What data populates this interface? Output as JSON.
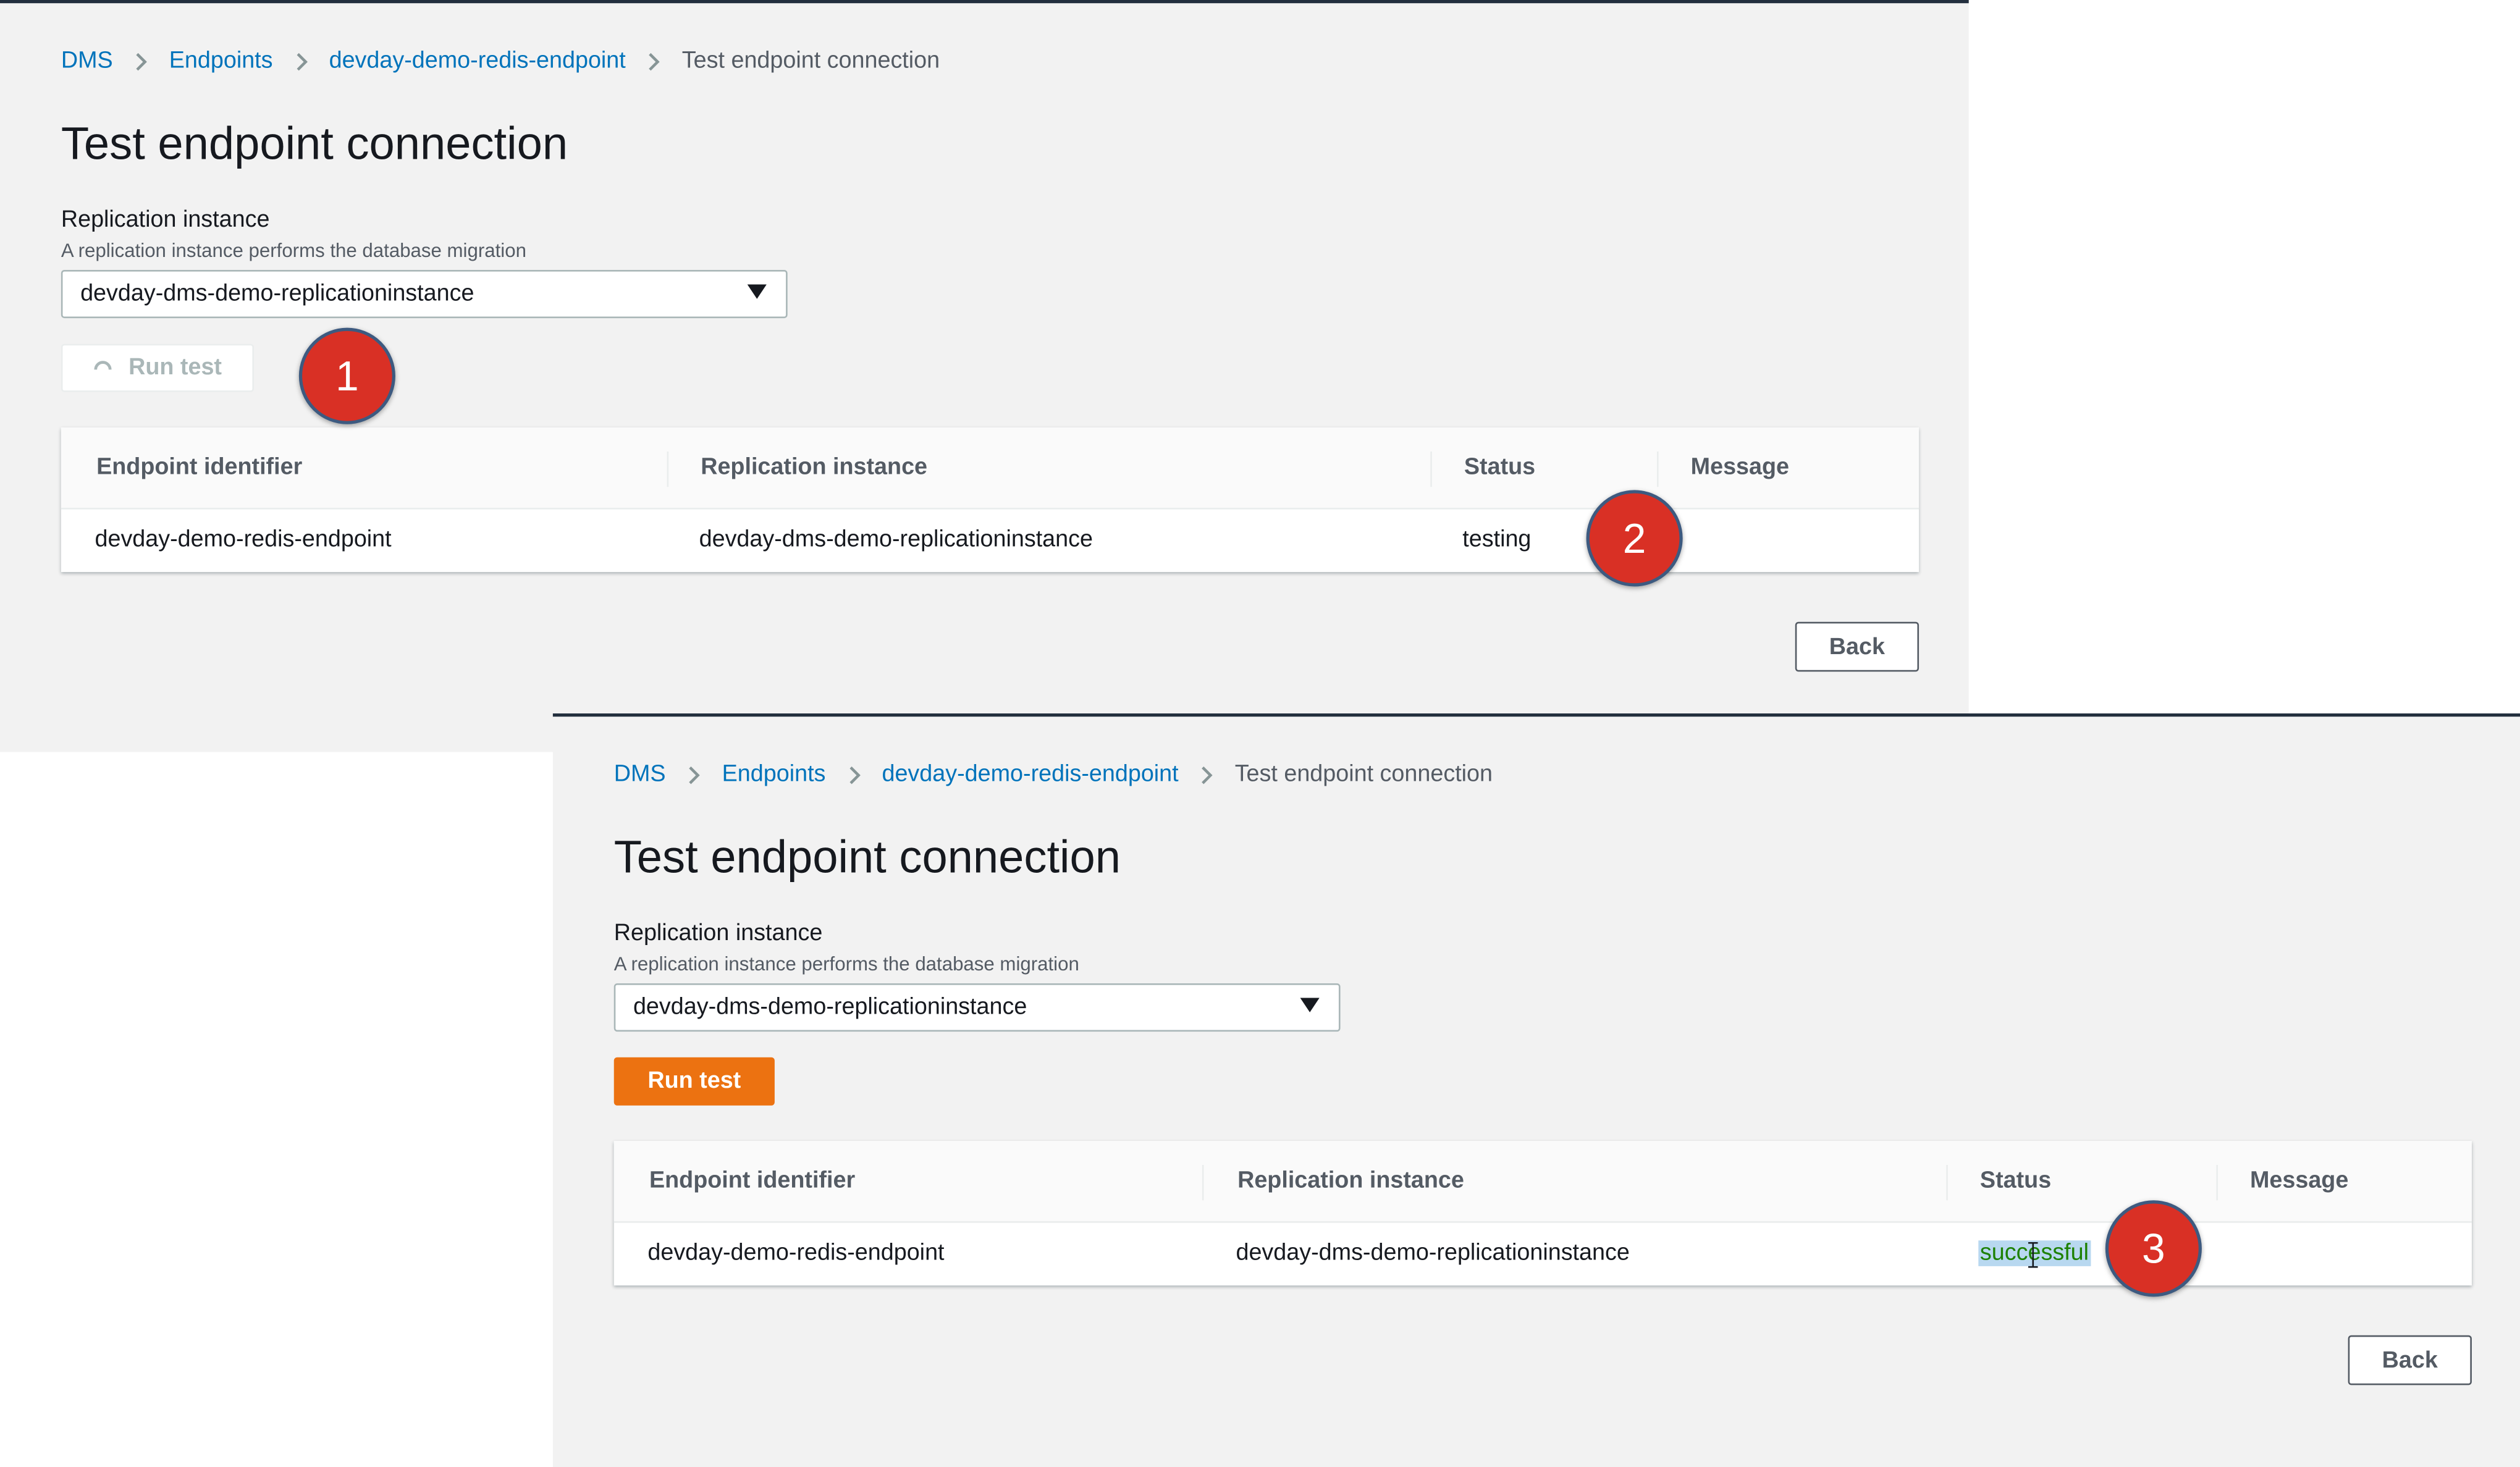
{
  "colors": {
    "link": "#0073bb",
    "primary_button": "#ec7211",
    "status_success": "#1d8102",
    "badge": "#d93025",
    "header_bar": "#232f3e"
  },
  "breadcrumb_icon": "chevron-right-icon",
  "screens": [
    {
      "breadcrumb": [
        {
          "label": "DMS",
          "link": true
        },
        {
          "label": "Endpoints",
          "link": true
        },
        {
          "label": "devday-demo-redis-endpoint",
          "link": true
        },
        {
          "label": "Test endpoint connection",
          "link": false
        }
      ],
      "title": "Test endpoint connection",
      "replication_field": {
        "label": "Replication instance",
        "description": "A replication instance performs the database migration",
        "selected": "devday-dms-demo-replicationinstance"
      },
      "run_button": {
        "label": "Run test",
        "state": "loading",
        "icon": "spinner-icon"
      },
      "table": {
        "columns": [
          "Endpoint identifier",
          "Replication instance",
          "Status",
          "Message"
        ],
        "rows": [
          {
            "endpoint": "devday-demo-redis-endpoint",
            "instance": "devday-dms-demo-replicationinstance",
            "status": "testing",
            "message": ""
          }
        ]
      },
      "back_label": "Back",
      "annotation": "1",
      "annotation_2": "2"
    },
    {
      "breadcrumb": [
        {
          "label": "DMS",
          "link": true
        },
        {
          "label": "Endpoints",
          "link": true
        },
        {
          "label": "devday-demo-redis-endpoint",
          "link": true
        },
        {
          "label": "Test endpoint connection",
          "link": false
        }
      ],
      "title": "Test endpoint connection",
      "replication_field": {
        "label": "Replication instance",
        "description": "A replication instance performs the database migration",
        "selected": "devday-dms-demo-replicationinstance"
      },
      "run_button": {
        "label": "Run test",
        "state": "enabled"
      },
      "table": {
        "columns": [
          "Endpoint identifier",
          "Replication instance",
          "Status",
          "Message"
        ],
        "rows": [
          {
            "endpoint": "devday-demo-redis-endpoint",
            "instance": "devday-dms-demo-replicationinstance",
            "status": "successful",
            "message": ""
          }
        ]
      },
      "back_label": "Back",
      "annotation": "3"
    }
  ]
}
